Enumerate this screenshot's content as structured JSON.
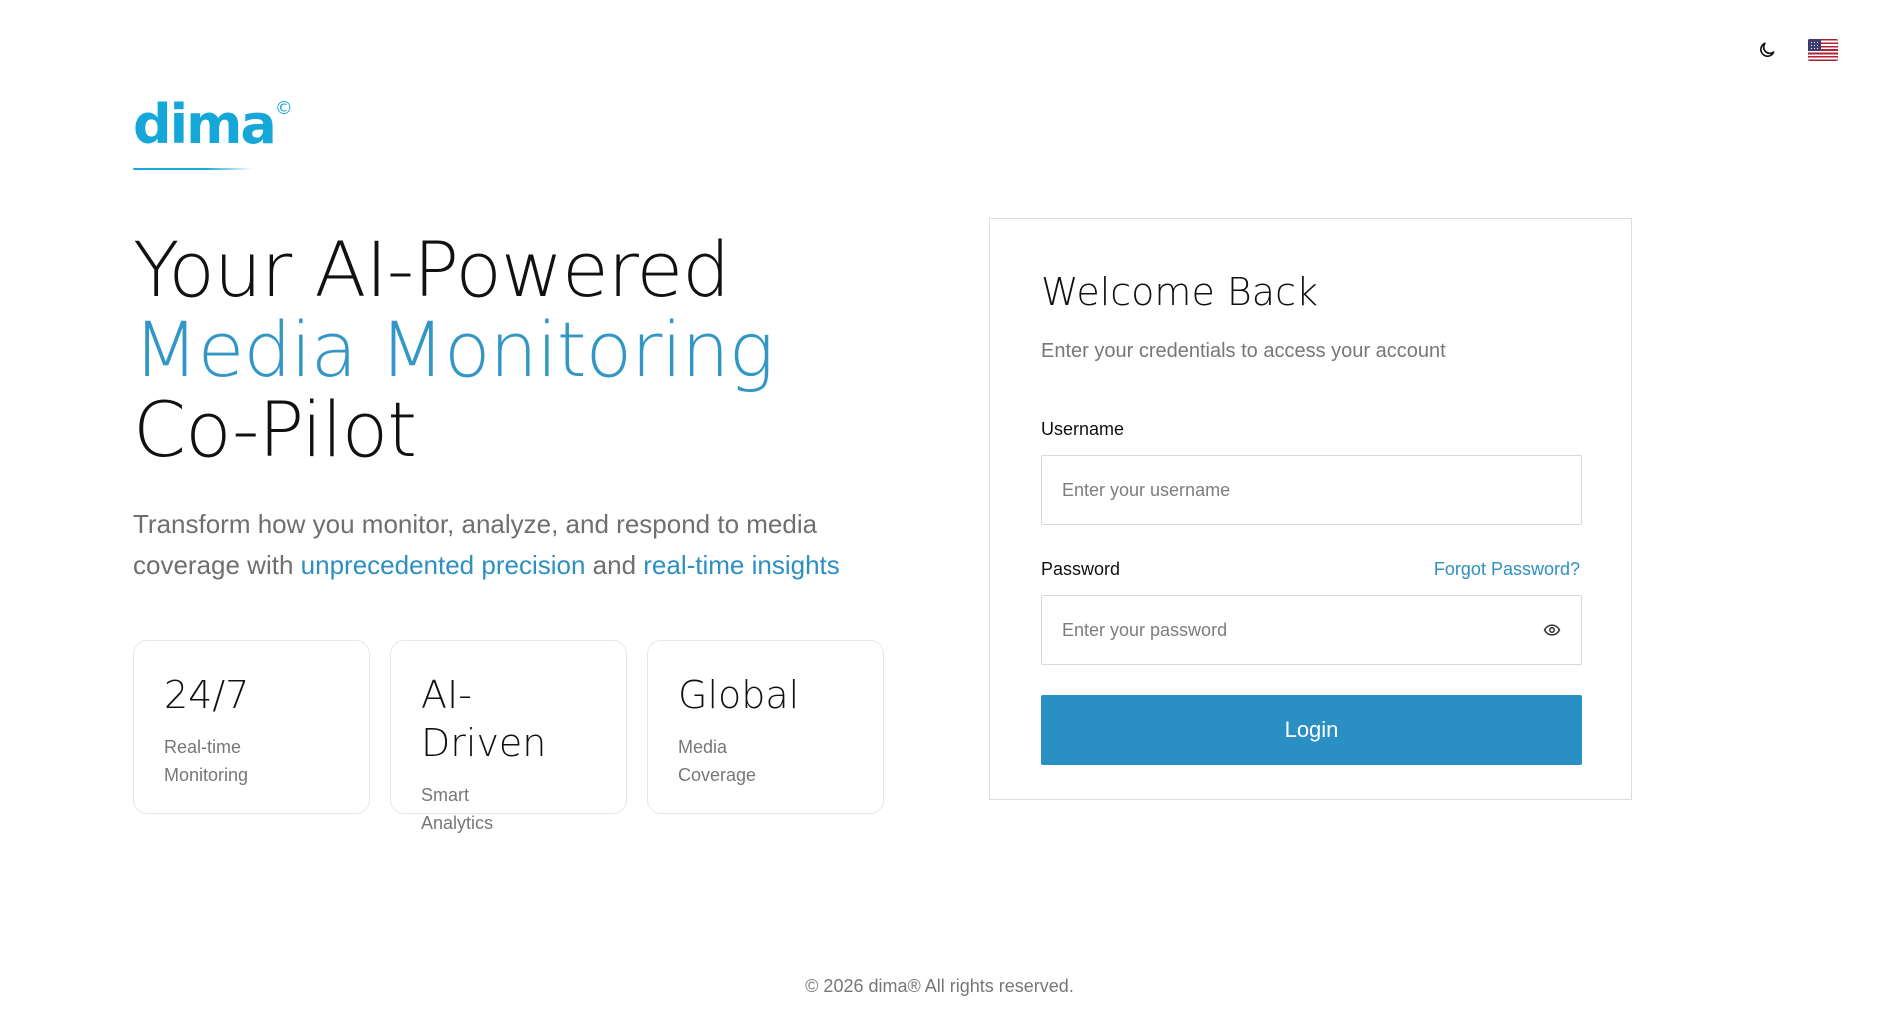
{
  "brand": {
    "logo_text": "dima",
    "logo_mark": "©"
  },
  "topbar": {
    "theme_icon": "moon-icon",
    "language_icon": "us-flag-icon"
  },
  "hero": {
    "headline": {
      "line1": "Your AI-Powered",
      "line2": "Media Monitoring",
      "line3": "Co-Pilot"
    },
    "description": {
      "text1": "Transform how you monitor, analyze, and respond to media coverage with ",
      "highlight1": "unprecedented precision",
      "text2": " and ",
      "highlight2": "real-time insights"
    }
  },
  "features": [
    {
      "title": "24/7",
      "description": "Real-time Monitoring"
    },
    {
      "title": "AI-Driven",
      "description": "Smart Analytics"
    },
    {
      "title": "Global",
      "description": "Media Coverage"
    }
  ],
  "login": {
    "title": "Welcome Back",
    "subtitle": "Enter your credentials to access your account",
    "username": {
      "label": "Username",
      "placeholder": "Enter your username",
      "value": ""
    },
    "password": {
      "label": "Password",
      "placeholder": "Enter your password",
      "value": "",
      "toggle_icon": "eye-icon"
    },
    "forgot_password": "Forgot Password?",
    "button_label": "Login"
  },
  "footer": {
    "text": "© 2026 dima® All rights reserved."
  },
  "colors": {
    "accent": "#2a8fc2",
    "logo": "#15a7d8",
    "border": "#dddddd",
    "muted_text": "#777777"
  }
}
